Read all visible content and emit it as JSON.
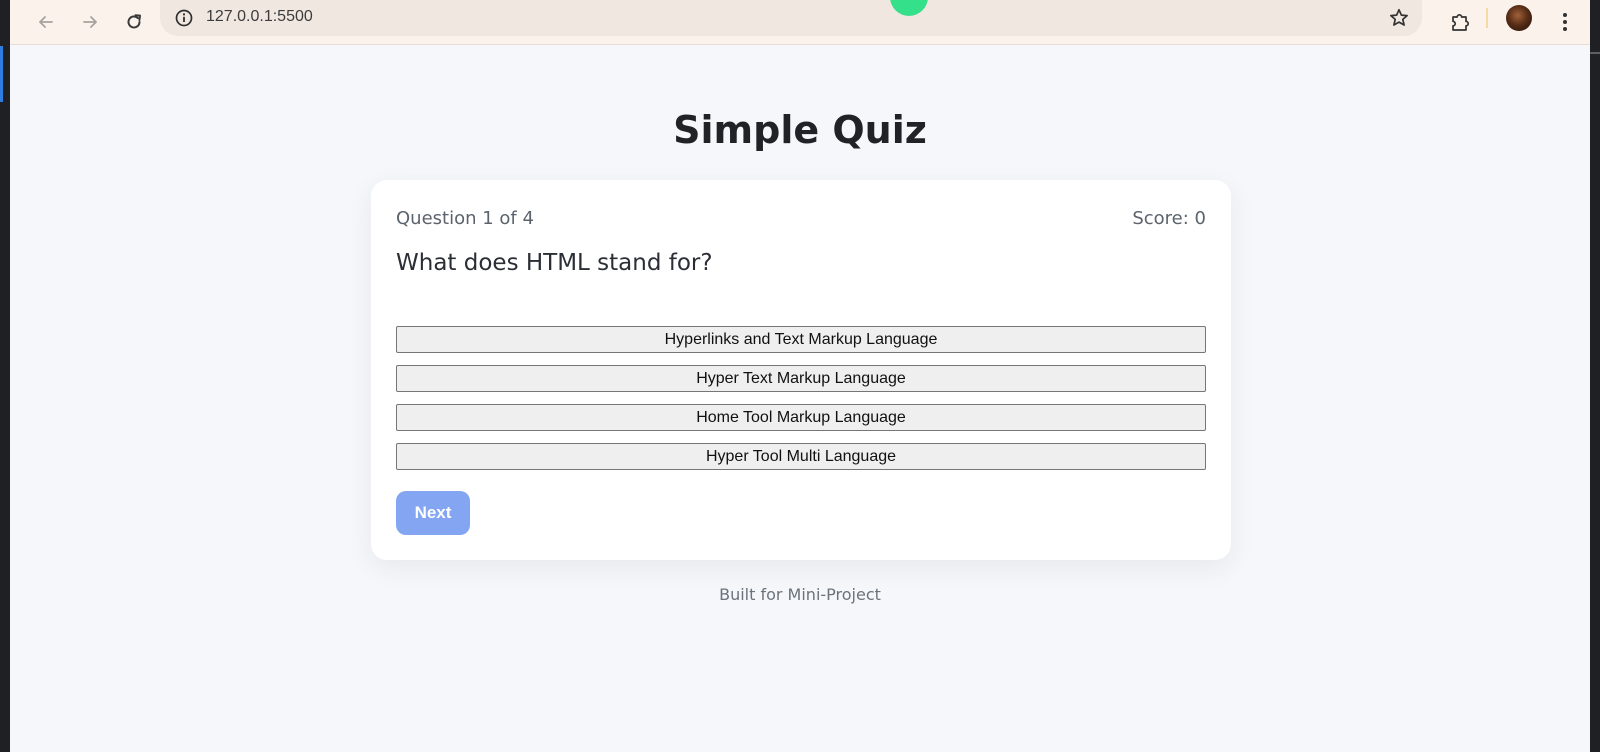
{
  "browser": {
    "url": "127.0.0.1:5500",
    "back_icon": "arrow-left-icon",
    "forward_icon": "arrow-right-icon",
    "reload_icon": "reload-icon",
    "site_info_icon": "info-icon",
    "bookmark_icon": "star-icon",
    "extensions_icon": "puzzle-icon",
    "menu_icon": "vertical-dots-icon",
    "indicator_color": "#34e08a"
  },
  "page": {
    "title": "Simple Quiz",
    "footer": "Built for Mini-Project"
  },
  "quiz": {
    "counter": "Question 1 of 4",
    "score": "Score: 0",
    "question": "What does HTML stand for?",
    "options": [
      "Hyperlinks and Text Markup Language",
      "Hyper Text Markup Language",
      "Home Tool Markup Language",
      "Hyper Tool Multi Language"
    ],
    "next_label": "Next",
    "next_color": "#84a5f2"
  }
}
